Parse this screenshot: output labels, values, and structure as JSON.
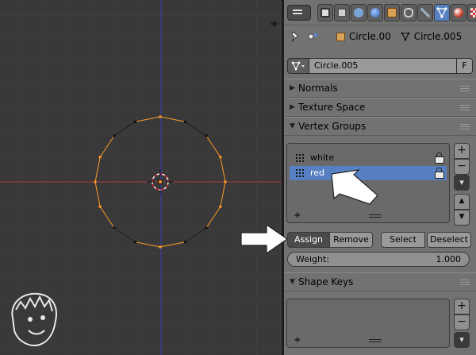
{
  "breadcrumb": {
    "object_name": "Circle.00",
    "mesh_name": "Circle.005"
  },
  "mesh_field": {
    "value": "Circle.005",
    "fake_user": "F"
  },
  "panels": {
    "normals": "Normals",
    "texture_space": "Texture Space",
    "vertex_groups": "Vertex Groups",
    "shape_keys": "Shape Keys"
  },
  "vertex_groups": [
    {
      "name": "white",
      "selected": false
    },
    {
      "name": "red",
      "selected": true
    }
  ],
  "buttons": {
    "assign": "Assign",
    "remove": "Remove",
    "select": "Select",
    "deselect": "Deselect"
  },
  "weight": {
    "label": "Weight:",
    "value": "1.000"
  },
  "side": {
    "add": "+",
    "remove": "−",
    "menu": "▾",
    "up": "▲",
    "down": "▼"
  },
  "colors": {
    "viewport_bg": "#393939",
    "panel_bg": "#727272",
    "selected_blue": "#5680c2",
    "selected_vertex": "#ff9b29",
    "x_axis": "#a23b3b",
    "y_axis": "#3f3fb3"
  },
  "icons": {
    "editor_type": "properties-editor-icon",
    "pin": "pin-icon",
    "object": "cube-icon",
    "mesh": "mesh-icon",
    "vertex_group": "vertex-group-icon",
    "lock": "lock-icon"
  }
}
